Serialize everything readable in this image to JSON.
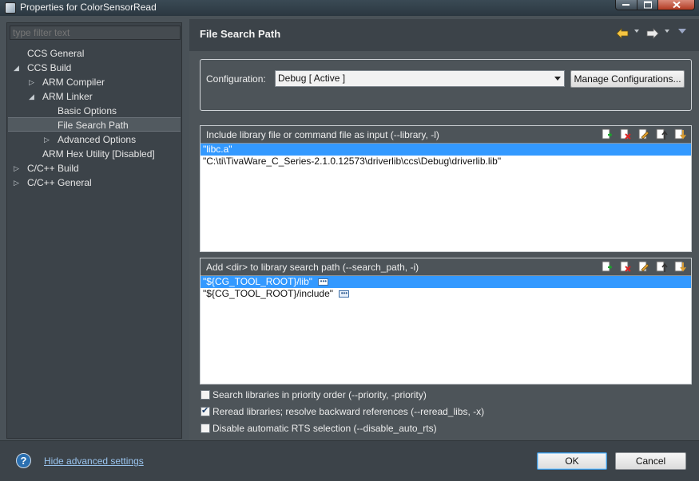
{
  "window": {
    "title": "Properties for ColorSensorRead"
  },
  "filter": {
    "placeholder": "type filter text"
  },
  "tree": [
    {
      "label": "CCS General",
      "twisty": ""
    },
    {
      "label": "CCS Build",
      "twisty": "◢"
    },
    {
      "label": "ARM Compiler",
      "twisty": "▷"
    },
    {
      "label": "ARM Linker",
      "twisty": "◢"
    },
    {
      "label": "Basic Options",
      "twisty": ""
    },
    {
      "label": "File Search Path",
      "twisty": ""
    },
    {
      "label": "Advanced Options",
      "twisty": "▷"
    },
    {
      "label": "ARM Hex Utility  [Disabled]",
      "twisty": ""
    },
    {
      "label": "C/C++ Build",
      "twisty": "▷"
    },
    {
      "label": "C/C++ General",
      "twisty": "▷"
    }
  ],
  "header": {
    "title": "File Search Path",
    "back_icon": "back-arrow-icon",
    "forward_icon": "forward-arrow-icon",
    "menu_icon": "view-menu-icon"
  },
  "config": {
    "label": "Configuration:",
    "selected": "Debug  [ Active ]",
    "manage_button": "Manage Configurations..."
  },
  "library_panel": {
    "title": "Include library file or command file as input (--library, -l)",
    "items": [
      "\"libc.a\"",
      "\"C:\\ti\\TivaWare_C_Series-2.1.0.12573\\driverlib\\ccs\\Debug\\driverlib.lib\""
    ],
    "selected_index": 0
  },
  "search_path_panel": {
    "title": "Add <dir> to library search path (--search_path, -i)",
    "items": [
      "\"${CG_TOOL_ROOT}/lib\"",
      "\"${CG_TOOL_ROOT}/include\""
    ],
    "selected_index": 0
  },
  "tool_icons": [
    "add-icon",
    "delete-icon",
    "edit-icon",
    "move-up-icon",
    "move-down-icon"
  ],
  "checkboxes": [
    {
      "label": "Search libraries in priority order (--priority, -priority)",
      "checked": false
    },
    {
      "label": "Reread libraries; resolve backward references (--reread_libs, -x)",
      "checked": true
    },
    {
      "label": "Disable automatic RTS selection (--disable_auto_rts)",
      "checked": false
    }
  ],
  "footer": {
    "help": "?",
    "hide_link": "Hide advanced settings",
    "ok": "OK",
    "cancel": "Cancel"
  },
  "colors": {
    "selection": "#3399ff",
    "link": "#9ac4ee",
    "panel_bg": "#4d5459",
    "sidebar_bg": "#3c4349"
  }
}
